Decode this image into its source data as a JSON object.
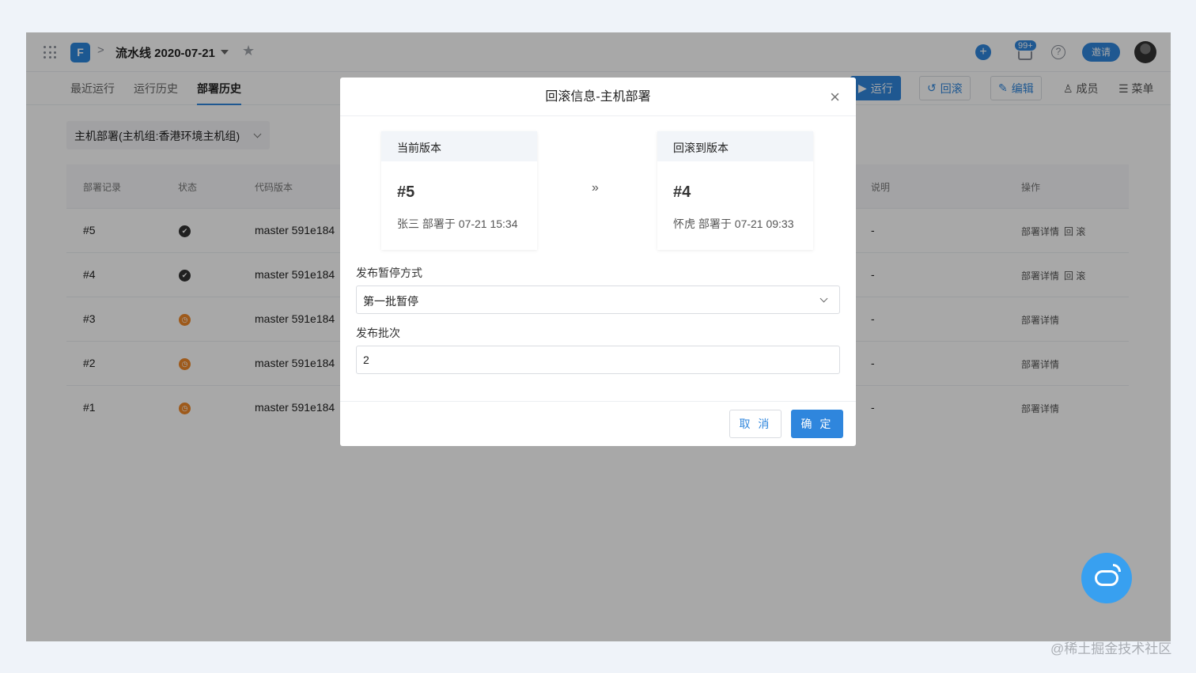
{
  "header": {
    "logo_glyph": "F",
    "crumb_sep": ">",
    "pipeline_name": "流水线 2020-07-21",
    "plus_glyph": "+",
    "notif_badge": "99+",
    "help_glyph": "?",
    "invite_label": "邀请"
  },
  "tabs": [
    {
      "label": "最近运行"
    },
    {
      "label": "运行历史"
    },
    {
      "label": "部署历史"
    }
  ],
  "toolbar": {
    "run_label": "运行",
    "rollback_label": "回滚",
    "edit_label": "编辑",
    "members_label": "成员",
    "menu_label": "菜单"
  },
  "host_select": {
    "value": "主机部署(主机组:香港环境主机组)"
  },
  "table": {
    "headers": {
      "record": "部署记录",
      "status": "状态",
      "version": "代码版本",
      "desc": "说明",
      "ops": "操作"
    },
    "rows": [
      {
        "id": "#5",
        "status": "done",
        "version": "master  591e184",
        "desc": "-",
        "detail": "部署详情",
        "rollback": "回 滚"
      },
      {
        "id": "#4",
        "status": "done",
        "version": "master  591e184",
        "desc": "-",
        "detail": "部署详情",
        "rollback": "回 滚"
      },
      {
        "id": "#3",
        "status": "pending",
        "version": "master  591e184",
        "desc": "-",
        "detail": "部署详情",
        "rollback": ""
      },
      {
        "id": "#2",
        "status": "pending",
        "version": "master  591e184",
        "desc": "-",
        "detail": "部署详情",
        "rollback": ""
      },
      {
        "id": "#1",
        "status": "pending",
        "version": "master  591e184",
        "desc": "-",
        "detail": "部署详情",
        "rollback": ""
      }
    ]
  },
  "modal": {
    "title": "回滚信息-主机部署",
    "close_glyph": "×",
    "current": {
      "heading": "当前版本",
      "number": "#5",
      "meta": "张三 部署于 07-21 15:34"
    },
    "arrow_glyph": "»",
    "target": {
      "heading": "回滚到版本",
      "number": "#4",
      "meta": "怀虎 部署于 07-21 09:33"
    },
    "pause_label": "发布暂停方式",
    "pause_value": "第一批暂停",
    "batch_label": "发布批次",
    "batch_value": "2",
    "cancel_label": "取 消",
    "ok_label": "确 定"
  },
  "watermark": "@稀土掘金技术社区",
  "colors": {
    "accent": "#2f86dd",
    "pending": "#f0892a",
    "done": "#333333",
    "fab": "#38a0f0"
  }
}
